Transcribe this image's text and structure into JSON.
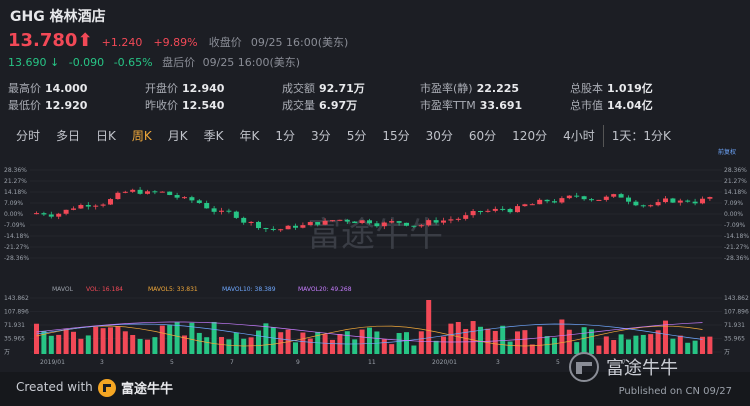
{
  "header": {
    "title": "GHG 格林酒店",
    "price": "13.780",
    "change": "+1.240",
    "change_pct": "+9.89%",
    "close_label": "收盘价",
    "close_time": "09/25 16:00(美东)",
    "after_price": "13.690",
    "after_change": "-0.090",
    "after_change_pct": "-0.65%",
    "after_label": "盘后价",
    "after_time": "09/25 16:00(美东)"
  },
  "stats": [
    {
      "label": "最高价",
      "value": "14.000",
      "color": "#f24957"
    },
    {
      "label": "开盘价",
      "value": "12.940",
      "color": "#f24957"
    },
    {
      "label": "成交额",
      "value": "92.71万",
      "color": "#e8e9ec"
    },
    {
      "label": "市盈率(静)",
      "value": "22.225",
      "color": "#e8e9ec"
    },
    {
      "label": "总股本",
      "value": "1.019亿",
      "color": "#e8e9ec"
    },
    {
      "label": "最低价",
      "value": "12.920",
      "color": "#f24957"
    },
    {
      "label": "昨收价",
      "value": "12.540",
      "color": "#e8e9ec"
    },
    {
      "label": "成交量",
      "value": "6.97万",
      "color": "#e8e9ec"
    },
    {
      "label": "市盈率TTM",
      "value": "33.691",
      "color": "#e8e9ec"
    },
    {
      "label": "总市值",
      "value": "14.04亿",
      "color": "#e8e9ec"
    }
  ],
  "tabs": [
    "分时",
    "多日",
    "日K",
    "周K",
    "月K",
    "季K",
    "年K",
    "1分",
    "3分",
    "5分",
    "15分",
    "30分",
    "60分",
    "120分",
    "4小时",
    "1天：1分K"
  ],
  "active_tab": 3,
  "chart": {
    "reset_label": "前复权",
    "y_left": [
      "28.36%",
      "21.27%",
      "14.18%",
      "7.09%",
      "0.00%",
      "-7.09%",
      "-14.18%",
      "-21.27%",
      "-28.36%"
    ],
    "y_right": [
      "28.36%",
      "21.27%",
      "14.18%",
      "7.09%",
      "0.00%",
      "-7.09%",
      "-14.18%",
      "-21.27%",
      "-28.36%"
    ],
    "vol_legend": [
      "MAVOL",
      "VOL: 16.184",
      "MAVOL5: 33.831",
      "MAVOL10: 38.389",
      "MAVOL20: 49.268"
    ],
    "vol_ticks": [
      "143.862",
      "107.896",
      "71.931",
      "35.965",
      "万"
    ],
    "x_labels": [
      "2019/01",
      "3",
      "5",
      "7",
      "9",
      "11",
      "2020/01",
      "3",
      "5",
      "7"
    ],
    "watermark": "富途牛牛"
  },
  "footer": {
    "created_with": "Created with",
    "brand": "富途牛牛",
    "published": "Published on CN 09/27"
  }
}
